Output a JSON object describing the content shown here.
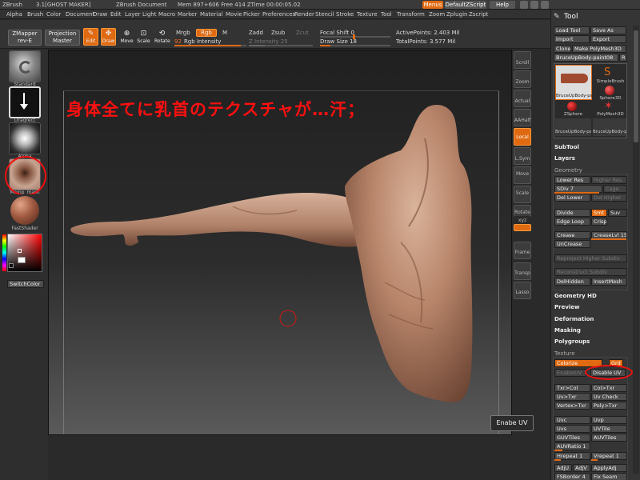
{
  "titlebar": {
    "app": "ZBrush",
    "version": "3.1[GHOST MAKER]",
    "document": "ZBrush Document",
    "mem_stats": "Mem 897+606  Free 414  ZTime 00:00:05.02",
    "menus_btn": "Menus",
    "script_btn": "DefaultZScript",
    "help_btn": "Help"
  },
  "menubar": [
    "Alpha",
    "Brush",
    "Color",
    "Document",
    "Draw",
    "Edit",
    "Layer",
    "Light",
    "Macro",
    "Marker",
    "Material",
    "Movie",
    "Picker",
    "Preferences",
    "Render",
    "Stencil",
    "Stroke",
    "Texture",
    "Tool",
    "Transform",
    "Zoom",
    "Zplugin",
    "Zscript"
  ],
  "shelf": {
    "zmapper": "ZMapper",
    "zmapper_sub": "rev-E",
    "projection": "Projection",
    "projection_sub": "Master",
    "edit": "Edit",
    "draw": "Draw",
    "move": "Move",
    "scale": "Scale",
    "rotate": "Rotate",
    "mrgb": "Mrgb",
    "rgb": "Rgb",
    "m": "M",
    "rgb_intensity_value": "92",
    "rgb_intensity_label": "Rgb Intensity",
    "zadd": "Zadd",
    "zsub": "Zsub",
    "zcut": "Zcut",
    "z_intensity": "Z Intensity 25",
    "focal_shift": "Focal Shift 0",
    "draw_size": "Draw Size 18",
    "active_points": "ActivePoints: 2.403 Mil",
    "total_points": "TotalPoints: 3.577 Mil",
    "rgb_intensity_fraction": 0.92,
    "z_intensity_fraction": 0.25,
    "draw_size_fraction": 0.15
  },
  "left_tray": {
    "items": [
      "Standard",
      "Dragrect",
      "Alpha",
      "Mainp_mask",
      "FastShader"
    ],
    "switch_color": "SwitchColor"
  },
  "canvas": {
    "note": "身体全てに乳首のテクスチャが…汗；"
  },
  "right_tools": [
    "Scroll",
    "Zoom",
    "Actual",
    "AAHalf",
    "Local",
    "L.Sym",
    "Move",
    "Scale",
    "Rotate",
    "xyz",
    "",
    "Frame",
    "Transp",
    "Lasso"
  ],
  "palette": {
    "title": "Tool",
    "load_tool": "Load Tool",
    "save_as": "Save As",
    "import": "Import",
    "export": "Export",
    "clone": "Clone",
    "make_polymesh": "Make PolyMesh3D",
    "current_tool": "BruceUpBody-paint08",
    "current_count": "R",
    "tool_items": [
      "BruceUpBody-pa",
      "SimpleBrush",
      "Sphere3D",
      "ZSphere",
      "PolyMesh3D",
      "BruceUpBody-pa",
      "BruceUpBody-pa"
    ],
    "subtool": "SubTool",
    "layers": "Layers",
    "geometry": "Geometry",
    "lower_res": "Lower Res",
    "higher_res": "Higher Res",
    "sdiv": "SDiv 7",
    "cage": "Cage",
    "del_lower": "Del Lower",
    "del_higher": "Del Higher",
    "divide": "Divide",
    "smt": "Smt",
    "suv": "Suv",
    "edge_loop": "Edge Loop",
    "crisp": "Crisp",
    "crease": "Crease",
    "crease_lvl": "CreaseLvl 15",
    "uncrease": "UnCrease",
    "reproject": "Reproject Higher Subdiv",
    "reconstruct": "Reconstruct Subdiv",
    "del_hidden": "DelHidden",
    "insert_mesh": "InsertMesh",
    "geometry_hd": "Geometry HD",
    "preview": "Preview",
    "deformation": "Deformation",
    "masking": "Masking",
    "polygroups": "Polygroups",
    "texture": "Texture",
    "colorize": "Colorize",
    "grd": "Grd",
    "enable_uv": "EnableUV",
    "disable_uv": "Disable UV",
    "txr_col": "Txr>Col",
    "col_txr": "Col>Txr",
    "uv_txr": "Uv>Txr",
    "uv_check": "Uv Check",
    "vertex_txr": "Vertex>Txr",
    "poly_txr": "Poly>Txr",
    "uvc": "Uvc",
    "uvp": "Uvp",
    "uvs": "Uvs",
    "uvtile": "UVTile",
    "guvtiles": "GUVTiles",
    "auvtiles": "AUVTiles",
    "auvratio": "AUVRatio 1",
    "hrepeat": "Hrepeat 1",
    "vrepeat": "Vrepeat 1",
    "adju": "AdjU",
    "adjv": "AdjV",
    "applyadj": "ApplyAdj",
    "fsborder": "FSBorder 4",
    "fix_seam": "Fix Seam"
  },
  "tooltip": "Enabe UV"
}
